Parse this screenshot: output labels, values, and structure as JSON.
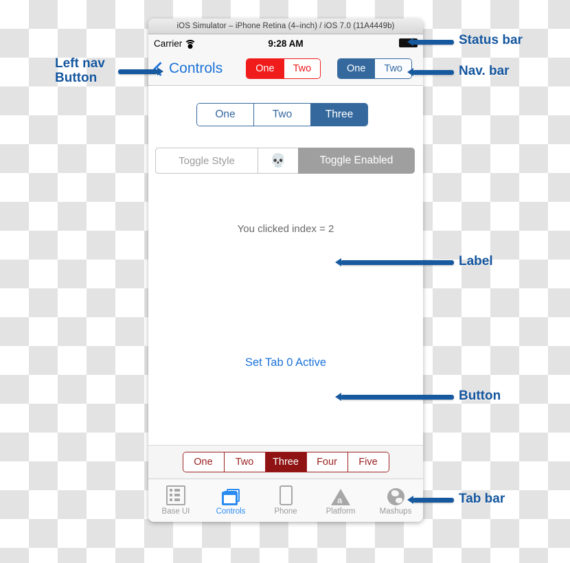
{
  "window": {
    "title": "iOS Simulator – iPhone Retina (4–inch) / iOS 7.0 (11A4449b)"
  },
  "status_bar": {
    "carrier": "Carrier",
    "wifi_icon": "wifi-icon",
    "time": "9:28 AM",
    "battery_icon": "battery-icon"
  },
  "nav_bar": {
    "back_icon": "chevron-left-icon",
    "back_label": "Controls",
    "red_segment": {
      "options": [
        "One",
        "Two"
      ],
      "selected": "One",
      "color": "#f01b1b"
    },
    "blue_segment": {
      "options": [
        "One",
        "Two"
      ],
      "selected": "One",
      "color": "#35699e"
    }
  },
  "content": {
    "main_segment": {
      "options": [
        "One",
        "Two",
        "Three"
      ],
      "selected": "Three",
      "color": "#35699e"
    },
    "toolbar": {
      "style_label": "Toggle Style",
      "skull_icon": "💀",
      "enabled_label": "Toggle Enabled"
    },
    "status_label": "You clicked index = 2",
    "action_button": "Set Tab 0 Active"
  },
  "bottom_bar": {
    "segment": {
      "options": [
        "One",
        "Two",
        "Three",
        "Four",
        "Five"
      ],
      "selected": "Three",
      "color": "#8f1313"
    }
  },
  "tab_bar": {
    "selected": "Controls",
    "accent": "#2b8cf0",
    "tabs": [
      {
        "label": "Base UI",
        "icon": "list-icon"
      },
      {
        "label": "Controls",
        "icon": "windows-icon"
      },
      {
        "label": "Phone",
        "icon": "phone-icon"
      },
      {
        "label": "Platform",
        "icon": "triangle-a-icon"
      },
      {
        "label": "Mashups",
        "icon": "globe-icon"
      }
    ]
  },
  "annotations": {
    "color": "#14569e",
    "left_nav_button": "Left nav\nButton",
    "status_bar": "Status bar",
    "nav_bar": "Nav. bar",
    "label": "Label",
    "button": "Button",
    "tab_bar": "Tab bar"
  }
}
